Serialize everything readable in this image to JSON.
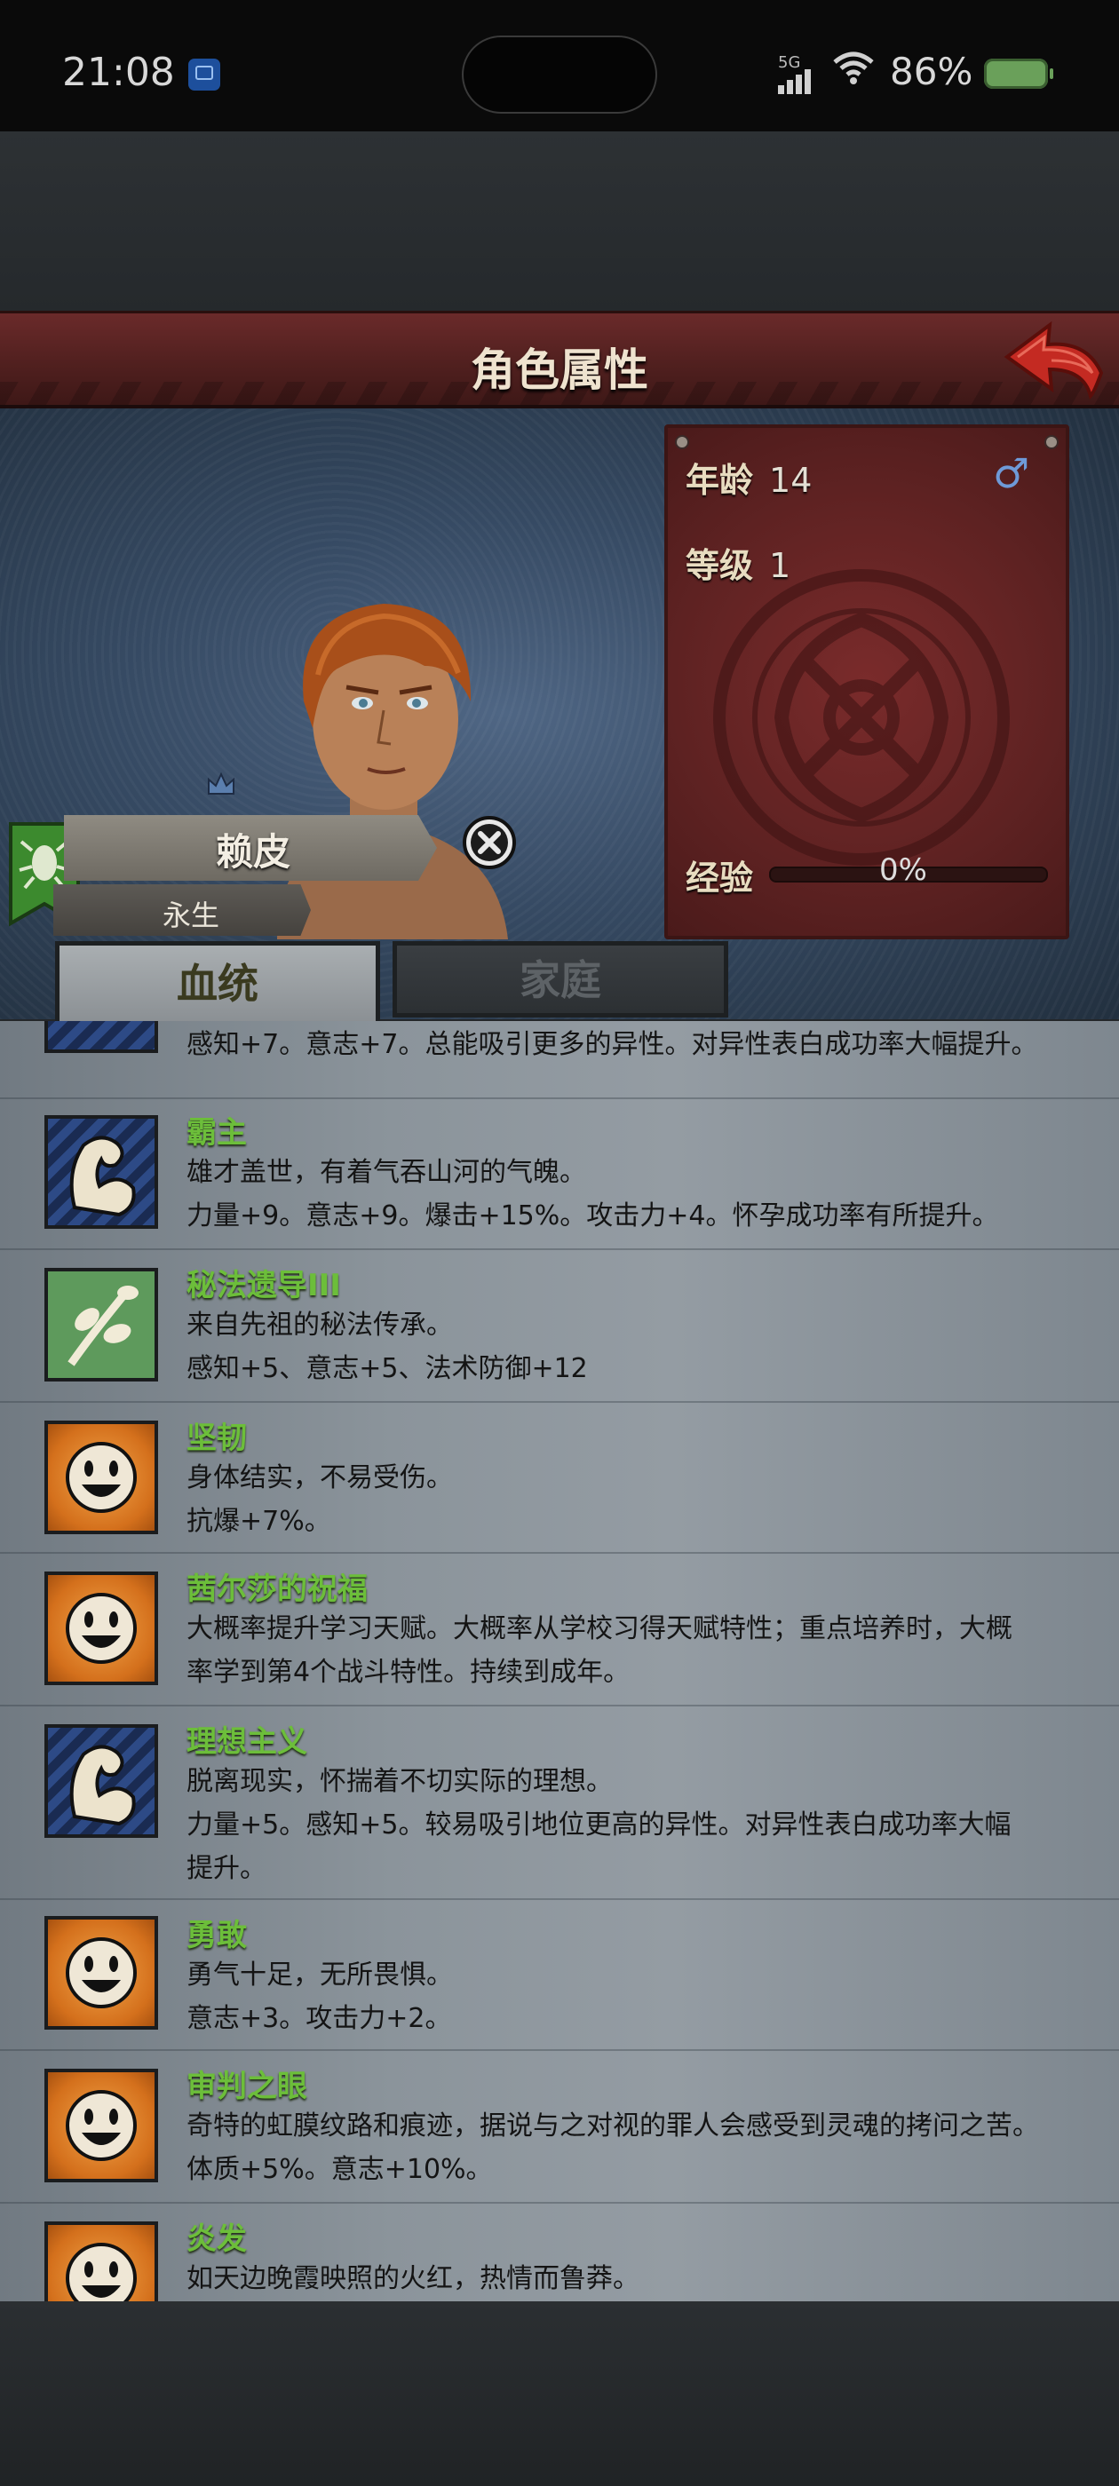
{
  "status_bar": {
    "time": "21:08",
    "network": "5G",
    "battery": "86%"
  },
  "header": {
    "title": "角色属性"
  },
  "character": {
    "name": "赖皮",
    "subtitle": "永生",
    "age_label": "年龄",
    "age_value": "14",
    "level_label": "等级",
    "level_value": "1",
    "exp_label": "经验",
    "exp_value": "0%",
    "exp_fraction": 0
  },
  "tabs": [
    {
      "label": "血统",
      "active": true
    },
    {
      "label": "家庭",
      "active": false
    }
  ],
  "traits": [
    {
      "icon": "blue-arm",
      "name": "",
      "lines": [
        "感知+7。意志+7。总能吸引更多的异性。对异性表白成功率大幅提升。"
      ]
    },
    {
      "icon": "blue-arm",
      "name": "霸主",
      "lines": [
        "雄才盖世，有着气吞山河的气魄。",
        "力量+9。意志+9。爆击+15%。攻击力+4。怀孕成功率有所提升。"
      ]
    },
    {
      "icon": "green-branch",
      "name": "秘法遗导III",
      "lines": [
        "来自先祖的秘法传承。",
        "感知+5、意志+5、法术防御+12"
      ]
    },
    {
      "icon": "orange-face",
      "name": "坚韧",
      "lines": [
        "身体结实，不易受伤。",
        "抗爆+7%。"
      ]
    },
    {
      "icon": "orange-face",
      "name": "茜尔莎的祝福",
      "lines": [
        "大概率提升学习天赋。大概率从学校习得天赋特性；重点培养时，大概",
        "率学到第4个战斗特性。持续到成年。"
      ]
    },
    {
      "icon": "blue-arm",
      "name": "理想主义",
      "lines": [
        "脱离现实，怀揣着不切实际的理想。",
        "力量+5。感知+5。较易吸引地位更高的异性。对异性表白成功率大幅",
        "提升。"
      ]
    },
    {
      "icon": "orange-face",
      "name": "勇敢",
      "lines": [
        "勇气十足，无所畏惧。",
        "意志+3。攻击力+2。"
      ]
    },
    {
      "icon": "orange-face",
      "name": "审判之眼",
      "lines": [
        "奇特的虹膜纹路和痕迹，据说与之对视的罪人会感受到灵魂的拷问之苦。",
        "体质+5%。意志+10%。"
      ]
    },
    {
      "icon": "orange-face",
      "name": "炎发",
      "lines": [
        "如天边晚霞映照的火红，热情而鲁莽。"
      ]
    }
  ]
}
